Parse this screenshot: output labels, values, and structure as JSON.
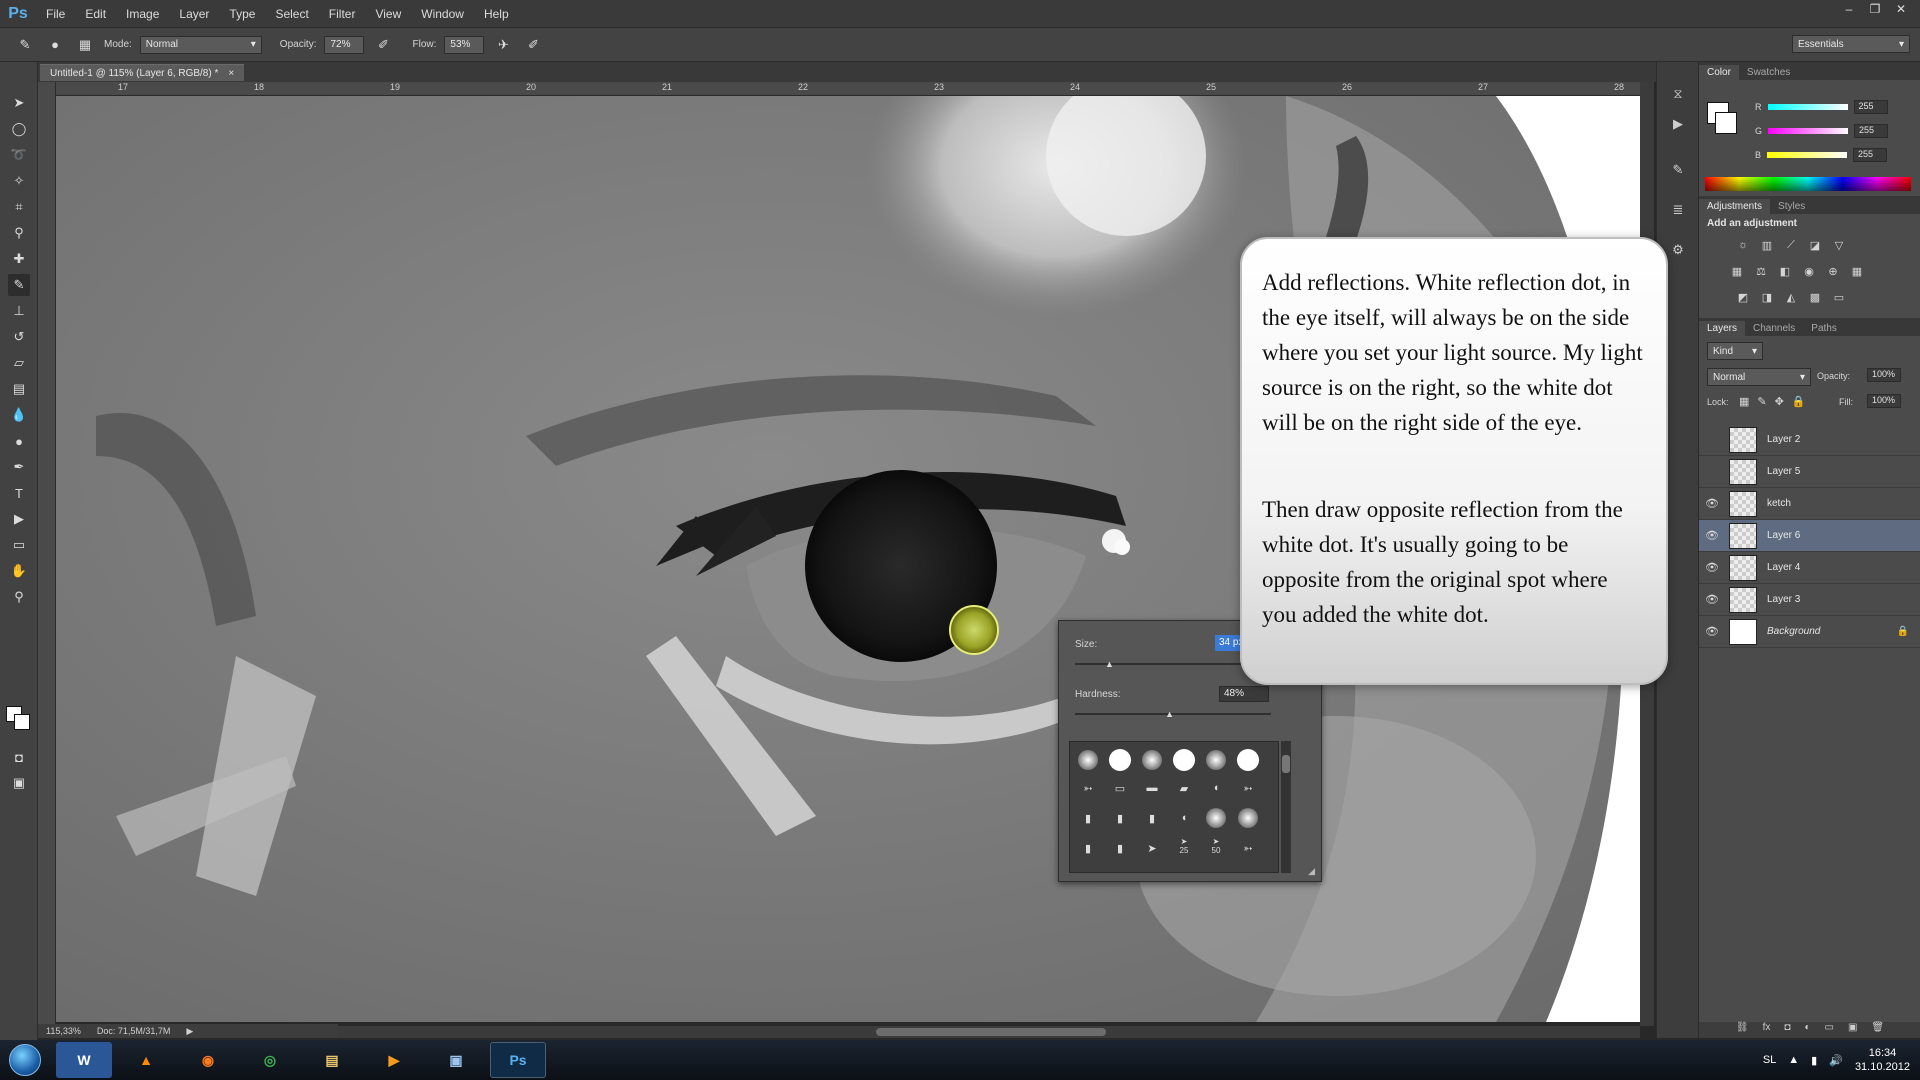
{
  "app": {
    "logo": "Ps",
    "menu": [
      "File",
      "Edit",
      "Image",
      "Layer",
      "Type",
      "Select",
      "Filter",
      "View",
      "Window",
      "Help"
    ],
    "window_controls": [
      "–",
      "❐",
      "✕"
    ]
  },
  "options_bar": {
    "mode_label": "Mode:",
    "mode_value": "Normal",
    "opacity_label": "Opacity:",
    "opacity_value": "72%",
    "flow_label": "Flow:",
    "flow_value": "53%",
    "workspace": "Essentials"
  },
  "document": {
    "tab_title": "Untitled-1 @ 115% (Layer 6, RGB/8) *",
    "zoom": "115,33%",
    "doc_size": "Doc: 71,5M/31,7M"
  },
  "ruler": {
    "top_numbers": [
      "17",
      "18",
      "19",
      "20",
      "21",
      "22",
      "23",
      "24",
      "25",
      "26",
      "27",
      "28"
    ]
  },
  "color_panel": {
    "tabs": [
      "Color",
      "Swatches"
    ],
    "channels": [
      {
        "label": "R",
        "value": "255",
        "color": "#ff3a3a"
      },
      {
        "label": "G",
        "value": "255",
        "color": "#3aff3a"
      },
      {
        "label": "B",
        "value": "255",
        "color": "#3a8bff"
      }
    ]
  },
  "adjustments_panel": {
    "tabs": [
      "Adjustments",
      "Styles"
    ],
    "heading": "Add an adjustment"
  },
  "layers_panel": {
    "tabs": [
      "Layers",
      "Channels",
      "Paths"
    ],
    "filter_kind": "Kind",
    "blend_mode": "Normal",
    "opacity_label": "Opacity:",
    "opacity_value": "100%",
    "lock_label": "Lock:",
    "fill_label": "Fill:",
    "fill_value": "100%",
    "layers": [
      {
        "name": "Layer 2",
        "visible": false,
        "selected": false
      },
      {
        "name": "Layer 5",
        "visible": false,
        "selected": false
      },
      {
        "name": "ketch",
        "visible": true,
        "selected": false
      },
      {
        "name": "Layer 6",
        "visible": true,
        "selected": true
      },
      {
        "name": "Layer 4",
        "visible": true,
        "selected": false
      },
      {
        "name": "Layer 3",
        "visible": true,
        "selected": false
      },
      {
        "name": "Background",
        "visible": true,
        "selected": false,
        "locked": true
      }
    ]
  },
  "brush_picker": {
    "size_label": "Size:",
    "size_value": "34 px",
    "hardness_label": "Hardness:",
    "hardness_value": "48%",
    "hardness_level": 0.48,
    "grid_numbers": [
      "25",
      "50"
    ]
  },
  "callout": {
    "paragraph1": "Add reflections. White reflection dot, in the eye itself, will always be on the side where you set your light source. My light source is on the right, so the white dot will be on the right side of the eye.",
    "paragraph2": "Then draw opposite reflection from the white dot. It's usually going to be opposite from the original spot where you added the white dot."
  },
  "taskbar": {
    "apps": [
      "W",
      "▲",
      "◉",
      "◎",
      "▤",
      "▶",
      "▣",
      "Ps"
    ],
    "language": "SL",
    "time": "16:34",
    "date": "31.10.2012"
  }
}
